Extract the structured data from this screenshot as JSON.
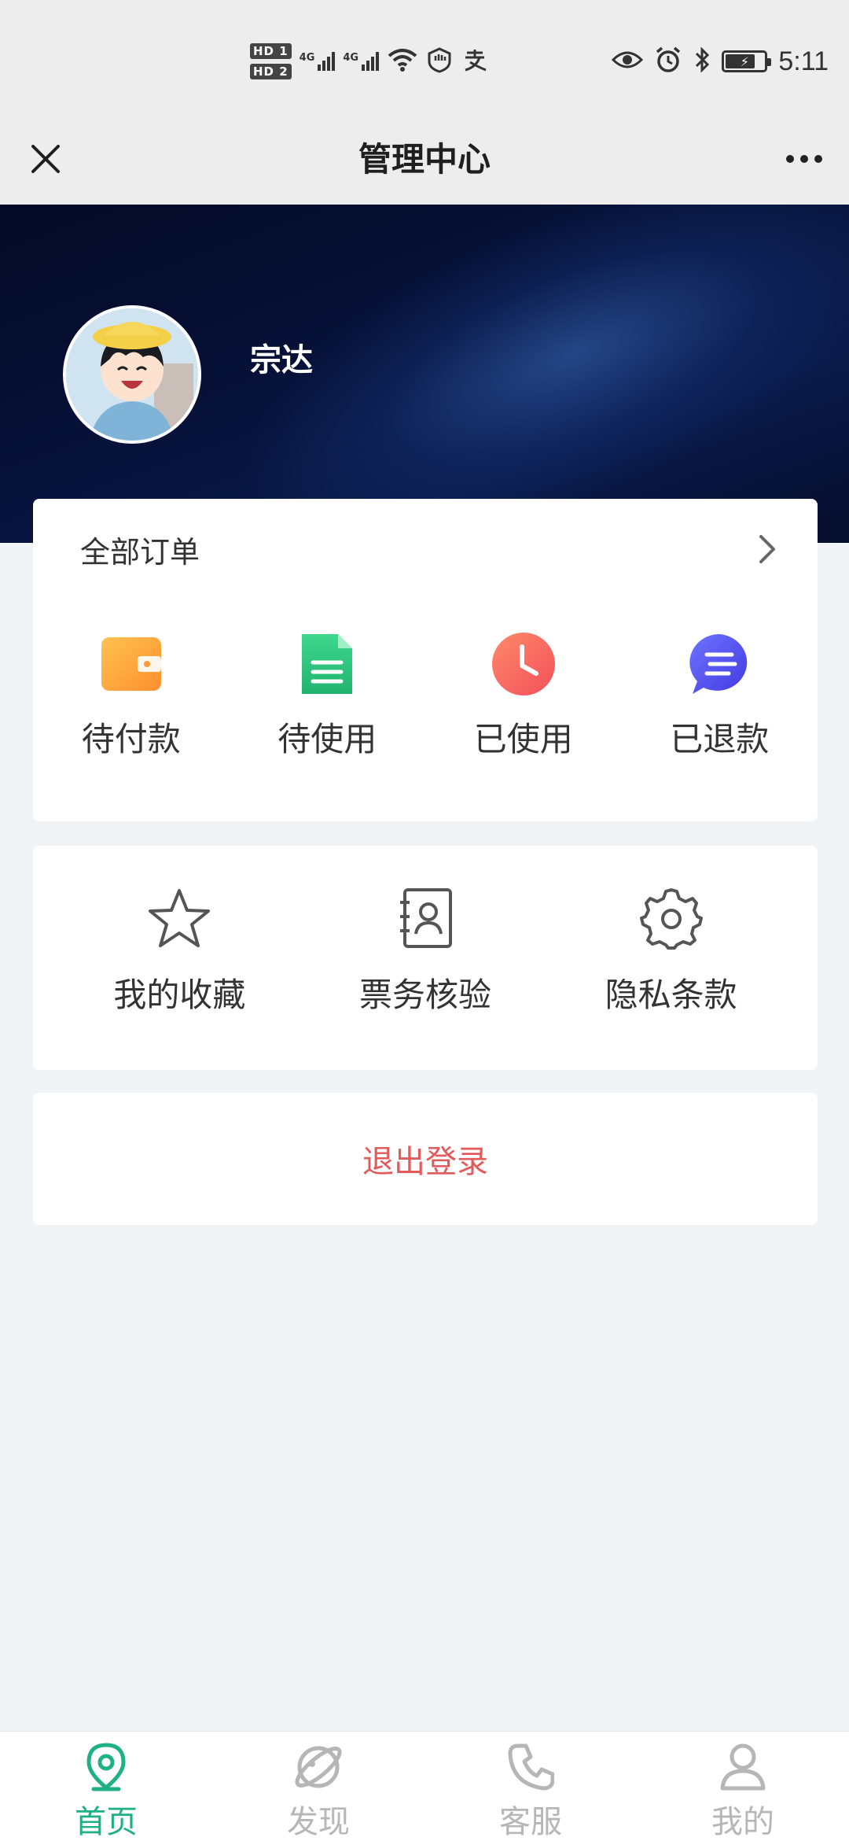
{
  "status_bar": {
    "hd1": "HD 1",
    "hd2": "HD 2",
    "net1": "4G",
    "net2": "4G",
    "time": "5:11",
    "icons": [
      "wifi-icon",
      "vpn-shield-icon",
      "alipay-icon",
      "eye-icon",
      "alarm-icon",
      "bluetooth-icon",
      "battery-charging-icon"
    ]
  },
  "title_bar": {
    "title": "管理中心",
    "close_icon": "close-icon",
    "more_icon": "more-icon"
  },
  "profile": {
    "username": "宗达",
    "avatar_icon": "avatar"
  },
  "orders": {
    "title": "全部订单",
    "items": [
      {
        "label": "待付款",
        "icon": "wallet-icon",
        "color": "#ffa73d"
      },
      {
        "label": "待使用",
        "icon": "document-icon",
        "color": "#2cc37f"
      },
      {
        "label": "已使用",
        "icon": "clock-icon",
        "color": "#ff6b5e"
      },
      {
        "label": "已退款",
        "icon": "chat-bubble-icon",
        "color": "#5b5cf2"
      }
    ]
  },
  "tools": {
    "items": [
      {
        "label": "我的收藏",
        "icon": "star-icon"
      },
      {
        "label": "票务核验",
        "icon": "contact-book-icon"
      },
      {
        "label": "隐私条款",
        "icon": "gear-icon"
      }
    ]
  },
  "logout": {
    "label": "退出登录",
    "color": "#e25a5a"
  },
  "tab_bar": {
    "active_color": "#1fb185",
    "inactive_color": "#b6b6b6",
    "tabs": [
      {
        "label": "首页",
        "icon": "location-pin-icon",
        "active": true
      },
      {
        "label": "发现",
        "icon": "planet-icon",
        "active": false
      },
      {
        "label": "客服",
        "icon": "phone-icon",
        "active": false
      },
      {
        "label": "我的",
        "icon": "user-icon",
        "active": false
      }
    ]
  }
}
